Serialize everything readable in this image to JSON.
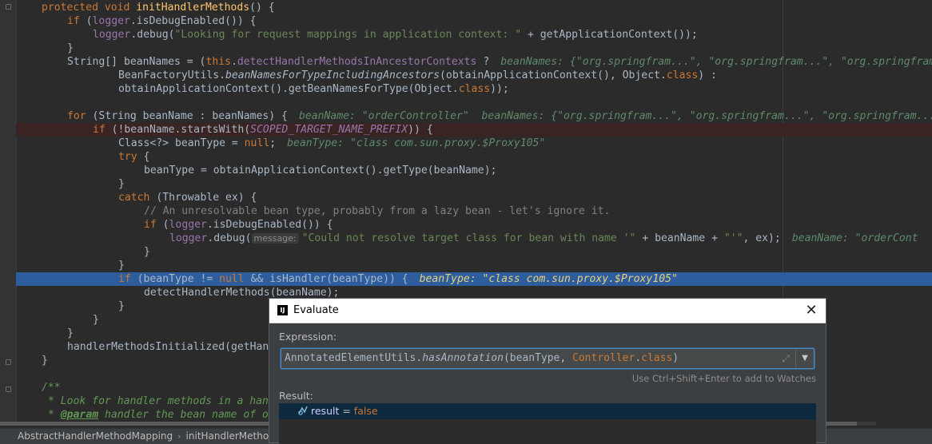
{
  "code_lines": [
    {
      "tokens": [
        [
          "kw",
          "protected void "
        ],
        [
          "fn",
          "initHandlerMethods"
        ],
        [
          "",
          "() {"
        ]
      ]
    },
    {
      "tokens": [
        [
          "kw",
          "if "
        ],
        [
          "",
          "("
        ],
        [
          "fld",
          "logger"
        ],
        [
          "",
          ".isDebugEnabled()) {"
        ]
      ]
    },
    {
      "tokens": [
        [
          "fld",
          "logger"
        ],
        [
          "",
          ".debug("
        ],
        [
          "str",
          "\"Looking for request mappings in application context: \""
        ],
        [
          "",
          " + getApplicationContext());"
        ]
      ]
    },
    {
      "tokens": [
        [
          "",
          "}"
        ]
      ]
    },
    {
      "tokens": [
        [
          "",
          "String[] beanNames = ("
        ],
        [
          "kw",
          "this"
        ],
        [
          "",
          "."
        ],
        [
          "fld",
          "detectHandlerMethodsInAncestorContexts"
        ],
        [
          "",
          " ?"
        ]
      ],
      "hint": "beanNames: {\"org.springfram...\", \"org.springfram...\", \"org.springfram..."
    },
    {
      "tokens": [
        [
          "",
          "BeanFactoryUtils."
        ],
        [
          "ital",
          "beanNamesForTypeIncludingAncestors"
        ],
        [
          "",
          "(obtainApplicationContext(), Object."
        ],
        [
          "kw",
          "class"
        ],
        [
          "",
          ") :"
        ]
      ]
    },
    {
      "tokens": [
        [
          "",
          "obtainApplicationContext().getBeanNamesForType(Object."
        ],
        [
          "kw",
          "class"
        ],
        [
          "",
          "));"
        ]
      ]
    },
    {
      "tokens": []
    },
    {
      "tokens": [
        [
          "kw",
          "for "
        ],
        [
          "",
          "(String beanName : beanNames) {"
        ]
      ],
      "hint": "beanName: \"orderController\"  beanNames: {\"org.springfram...\", \"org.springfram...\", \"org.springfram..."
    },
    {
      "tokens": [
        [
          "kw",
          "if "
        ],
        [
          "",
          "(!beanName.startsWith("
        ],
        [
          "cnst",
          "SCOPED_TARGET_NAME_PREFIX"
        ],
        [
          "",
          ")) {"
        ]
      ]
    },
    {
      "tokens": [
        [
          "",
          "Class<?> beanType = "
        ],
        [
          "kw",
          "null"
        ],
        [
          "",
          ";"
        ]
      ],
      "hint": "beanType: \"class com.sun.proxy.$Proxy105\""
    },
    {
      "tokens": [
        [
          "kw",
          "try "
        ],
        [
          "",
          "{"
        ]
      ]
    },
    {
      "tokens": [
        [
          "",
          "beanType = obtainApplicationContext().getType(beanName);"
        ]
      ]
    },
    {
      "tokens": [
        [
          "",
          "}"
        ]
      ]
    },
    {
      "tokens": [
        [
          "kw",
          "catch "
        ],
        [
          "",
          "(Throwable ex) {"
        ]
      ]
    },
    {
      "tokens": [
        [
          "cmt",
          "// An unresolvable bean type, probably from a lazy bean - let's ignore it."
        ]
      ]
    },
    {
      "tokens": [
        [
          "kw",
          "if "
        ],
        [
          "",
          "("
        ],
        [
          "fld",
          "logger"
        ],
        [
          "",
          ".isDebugEnabled()) {"
        ]
      ]
    },
    {
      "tokens": [
        [
          "fld",
          "logger"
        ],
        [
          "",
          ".debug("
        ],
        [
          "phint",
          "message:"
        ],
        [
          "str",
          "\"Could not resolve target class for bean with name '\""
        ],
        [
          "",
          " + beanName + "
        ],
        [
          "str",
          "\"'\""
        ],
        [
          "",
          ", ex);"
        ]
      ],
      "hint": "beanName: \"orderCont"
    },
    {
      "tokens": [
        [
          "",
          "}"
        ]
      ]
    },
    {
      "tokens": [
        [
          "",
          "}"
        ]
      ]
    },
    {
      "tokens": [
        [
          "kw",
          "if "
        ],
        [
          "",
          "(beanType != "
        ],
        [
          "kw",
          "null "
        ],
        [
          "",
          "&& isHandler(beanType)) {"
        ]
      ],
      "hint": "beanType: \"class com.sun.proxy.$Proxy105\""
    },
    {
      "tokens": [
        [
          "",
          "detectHandlerMethods(beanName);"
        ]
      ]
    },
    {
      "tokens": [
        [
          "",
          "}"
        ]
      ]
    },
    {
      "tokens": [
        [
          "",
          "}"
        ]
      ]
    },
    {
      "tokens": [
        [
          "",
          "}"
        ]
      ]
    },
    {
      "tokens": [
        [
          "",
          "handlerMethodsInitialized(getHan"
        ]
      ]
    },
    {
      "tokens": [
        [
          "",
          "}"
        ]
      ]
    },
    {
      "tokens": []
    },
    {
      "tokens": [
        [
          "doc",
          "/**"
        ]
      ]
    },
    {
      "tokens": [
        [
          "doc",
          "* Look for handler methods in a han"
        ]
      ]
    },
    {
      "tokens": [
        [
          "doc",
          "* "
        ],
        [
          "doctag",
          "@param"
        ],
        [
          "doc",
          " handler the bean name of o"
        ]
      ]
    },
    {
      "tokens": [
        [
          "doc",
          "*/"
        ]
      ]
    }
  ],
  "breadcrumb": {
    "class_name": "AbstractHandlerMethodMapping",
    "method_name": "initHandlerMetho"
  },
  "dialog": {
    "title": "Evaluate",
    "close_label": "✕",
    "expression_label": "Expression:",
    "expression_parts": [
      [
        "",
        "AnnotatedElementUtils."
      ],
      [
        "ital",
        "hasAnnotation"
      ],
      [
        "",
        "(beanType, "
      ],
      [
        "kw",
        "Controller"
      ],
      [
        "",
        "."
      ],
      [
        "kw",
        "class"
      ],
      [
        "",
        ")"
      ]
    ],
    "watch_hint": "Use Ctrl+Shift+Enter to add to Watches",
    "result_label": "Result:",
    "result": {
      "name": "result",
      "eq": " = ",
      "value": "false"
    }
  }
}
